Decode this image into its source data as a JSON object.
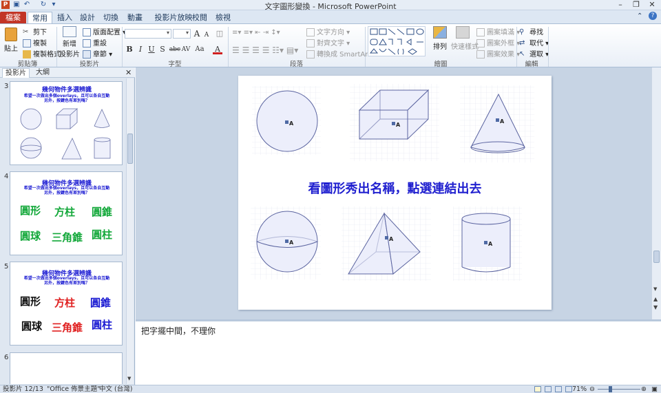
{
  "window": {
    "title": "文字圖形變換 - Microsoft PowerPoint"
  },
  "app_icon": "P",
  "tabs": [
    "檔案",
    "常用",
    "插入",
    "設計",
    "切換",
    "動畫",
    "投影片放映",
    "校閱",
    "檢視"
  ],
  "ribbon": {
    "clipboard": {
      "paste": "貼上",
      "cut": "剪下",
      "copy": "複製",
      "format_painter": "複製格式",
      "label": "剪貼簿"
    },
    "slides": {
      "new_slide_1": "新增",
      "new_slide_2": "投影片",
      "layout": "版面配置",
      "reset": "重設",
      "section": "章節",
      "label": "投影片"
    },
    "font": {
      "label": "字型",
      "bold": "B",
      "italic": "I",
      "underline": "U",
      "strike": "S",
      "abc": "abc",
      "av": "AV",
      "aa": "Aa",
      "a": "A",
      "grow": "A",
      "shrink": "A"
    },
    "paragraph": {
      "text_direction": "文字方向",
      "align_text": "對齊文字",
      "smartart": "轉換成 SmartArt",
      "label": "段落"
    },
    "drawing": {
      "arrange": "排列",
      "quick_styles": "快速樣式",
      "fill": "圖案填滿",
      "outline": "圖案外框",
      "effects": "圖案效果",
      "label": "繪圖"
    },
    "editing": {
      "find": "尋找",
      "replace": "取代",
      "select": "選取",
      "label": "編輯"
    }
  },
  "left_pane": {
    "tab_slides": "投影片",
    "tab_outline": "大綱"
  },
  "thumbnails": [
    {
      "num": "3",
      "title": "幾何物件多選辨識",
      "sub1": "希望一次做出多個overlays，且可以各自互動",
      "sub2": "另外，按鍵色有差別嗎？"
    },
    {
      "num": "4",
      "title": "幾何物件多選辨識",
      "sub1": "希望一次做出多個overlays，且可以各自互動",
      "sub2": "另外，按鍵色有差別嗎？",
      "words": [
        "圓形",
        "方柱",
        "圓錐",
        "圓球",
        "三角錐",
        "圓柱"
      ]
    },
    {
      "num": "5",
      "title": "幾何物件多選辨識",
      "sub1": "希望一次做出多個overlays，且可以各自互動",
      "sub2": "另外，按鍵色有差別嗎？",
      "words": [
        "圓形",
        "方柱",
        "圓錐",
        "圓球",
        "三角錐",
        "圓柱"
      ]
    },
    {
      "num": "6"
    }
  ],
  "slide": {
    "title": "看圖形秀出名稱，點選連結出去",
    "marker": "A"
  },
  "notes": "把字擺中間，不理你",
  "status": {
    "slide": "投影片 12/13",
    "theme": "\"Office 佈景主題\"",
    "lang": "中文 (台灣)",
    "zoom": "71%"
  }
}
